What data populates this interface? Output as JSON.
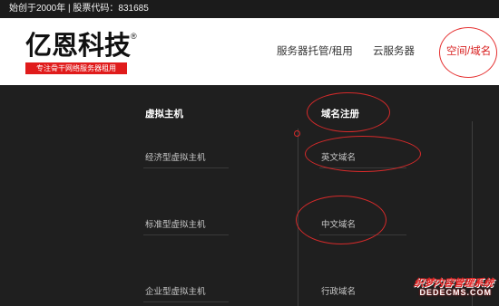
{
  "topbar": {
    "since_text": "始创于2000年 | 股票代码：831685"
  },
  "logo": {
    "name": "亿恩科技",
    "registered": "®",
    "tagline": "专注骨干网络服务器租用"
  },
  "nav": {
    "hosting": "服务器托管/租用",
    "cloud": "云服务器",
    "space_domain": "空间/域名"
  },
  "dropdown": {
    "virtual_host": {
      "heading": "虚拟主机",
      "items": [
        "经济型虚拟主机",
        "标准型虚拟主机",
        "企业型虚拟主机"
      ]
    },
    "domain": {
      "heading": "域名注册",
      "items": [
        "英文域名",
        "中文域名",
        "行政域名"
      ]
    }
  },
  "watermark": {
    "line1": "织梦内容管理系统",
    "line2": "DEDECMS.COM"
  },
  "colors": {
    "accent": "#e01b1b",
    "background": "#1f1f1f",
    "header_bg": "#ffffff"
  }
}
